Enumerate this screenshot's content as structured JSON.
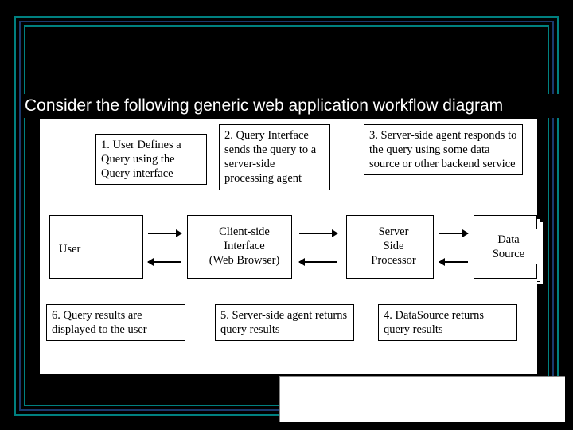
{
  "title": "Consider the following generic web application workflow diagram",
  "steps": {
    "s1": "1. User Defines a Query using the Query interface",
    "s2": "2. Query Interface sends the query to a server-side processing agent",
    "s3": "3. Server-side agent responds to the query using some data source or other backend service",
    "s4": "4. DataSource returns query results",
    "s5": "5. Server-side agent returns query results",
    "s6": "6. Query results are displayed to the user"
  },
  "entities": {
    "user": "User",
    "client": "Client-side\nInterface\n(Web Browser)",
    "server": "Server\nSide\nProcessor",
    "datasource": "Data\nSource"
  }
}
